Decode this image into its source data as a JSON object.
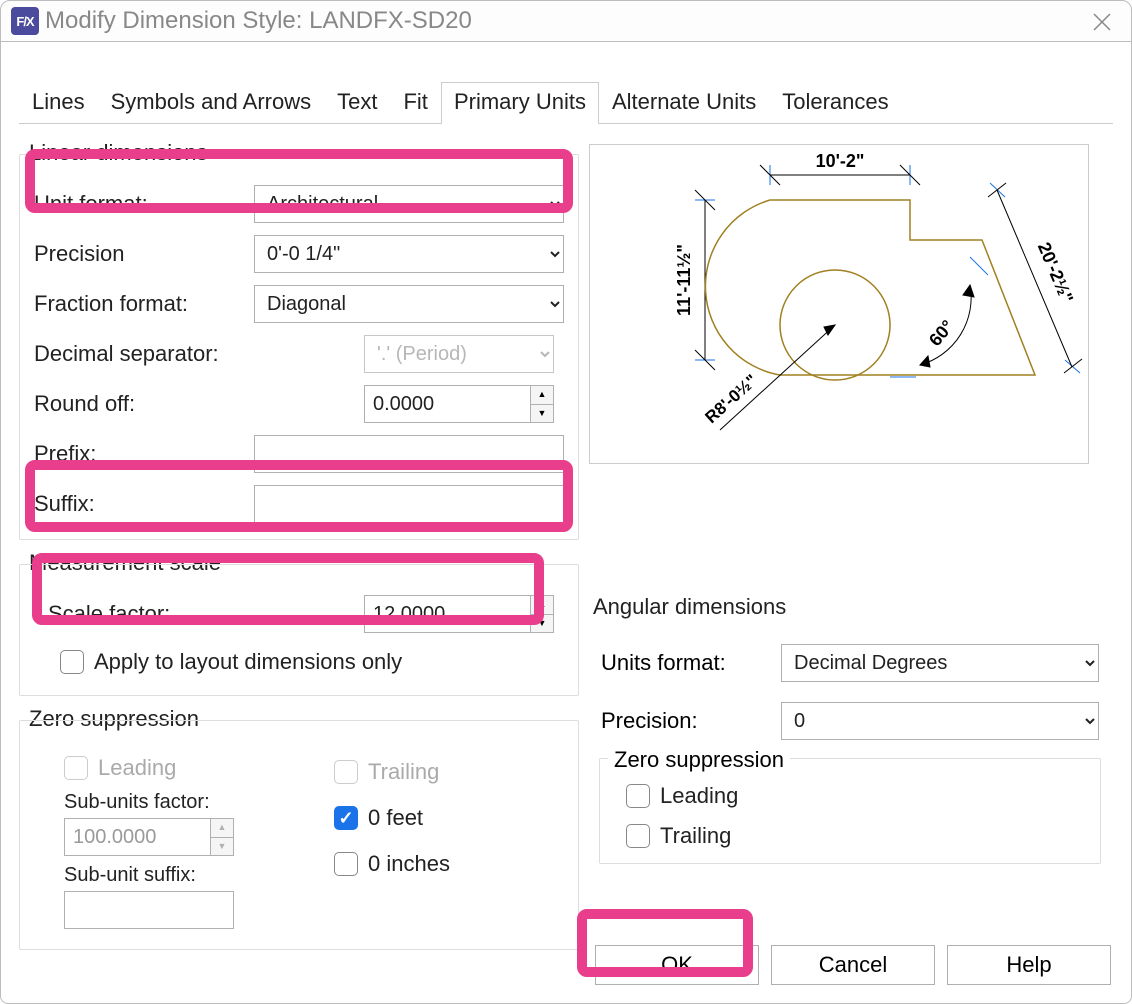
{
  "window": {
    "title": "Modify Dimension Style: LANDFX-SD20"
  },
  "tabs": [
    "Lines",
    "Symbols and Arrows",
    "Text",
    "Fit",
    "Primary Units",
    "Alternate Units",
    "Tolerances"
  ],
  "linear": {
    "groupLabel": "Linear dimensions",
    "unitFormat": {
      "label": "Unit format:",
      "value": "Architectural"
    },
    "precision": {
      "label": "Precision",
      "value": "0'-0 1/4\""
    },
    "fractionFormat": {
      "label": "Fraction format:",
      "value": "Diagonal"
    },
    "decimalSeparator": {
      "label": "Decimal separator:",
      "value": "'.' (Period)"
    },
    "roundOff": {
      "label": "Round off:",
      "value": "0.0000"
    },
    "prefix": {
      "label": "Prefix:",
      "value": ""
    },
    "suffix": {
      "label": "Suffix:",
      "value": ""
    }
  },
  "measurementScale": {
    "groupLabel": "Measurement scale",
    "scaleFactor": {
      "label": "Scale factor:",
      "value": "12.0000"
    },
    "applyLayout": "Apply to layout dimensions only"
  },
  "zeroSuppression": {
    "groupLabel": "Zero suppression",
    "leading": "Leading",
    "trailing": "Trailing",
    "subUnitsFactorLabel": "Sub-units factor:",
    "subUnitsFactorValue": "100.0000",
    "subUnitSuffixLabel": "Sub-unit suffix:",
    "subUnitSuffixValue": "",
    "feet": "0 feet",
    "inches": "0 inches"
  },
  "angular": {
    "groupLabel": "Angular dimensions",
    "unitsFormat": {
      "label": "Units format:",
      "value": "Decimal Degrees"
    },
    "precision": {
      "label": "Precision:",
      "value": "0"
    },
    "zeroGroup": "Zero suppression",
    "leading": "Leading",
    "trailing": "Trailing"
  },
  "previewLabels": {
    "top": "10'-2\"",
    "left": "11'-11½\"",
    "diag": "20'-2½\"",
    "angle": "60°",
    "radius": "R8'-0½\""
  },
  "buttons": {
    "ok": "OK",
    "cancel": "Cancel",
    "help": "Help"
  }
}
